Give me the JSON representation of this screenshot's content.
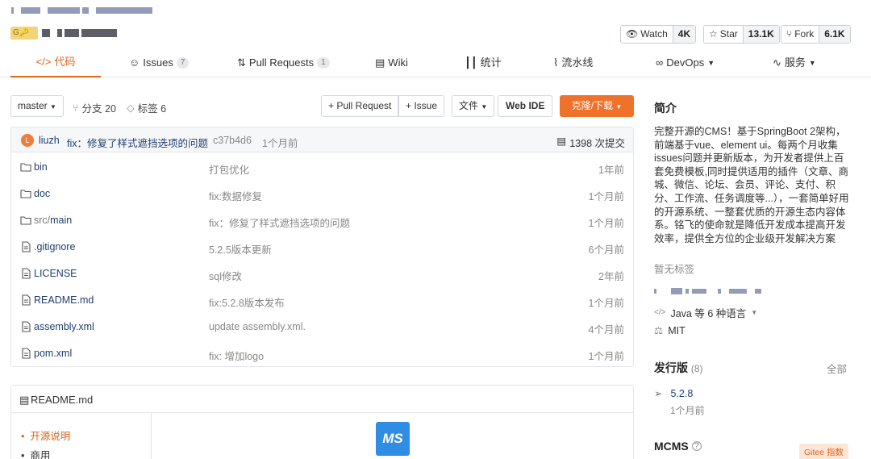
{
  "header": {
    "badge": "G",
    "stats": [
      {
        "label": "Watch",
        "icon": "eye-icon",
        "count": "4K"
      },
      {
        "label": "Star",
        "icon": "star-icon",
        "count": "13.1K"
      },
      {
        "label": "Fork",
        "icon": "fork-icon",
        "count": "6.1K"
      }
    ]
  },
  "tabs": [
    {
      "label": "代码",
      "icon": "code-icon",
      "count": ""
    },
    {
      "label": "Issues",
      "icon": "issues-icon",
      "count": "7"
    },
    {
      "label": "Pull Requests",
      "icon": "pull-request-icon",
      "count": "1"
    },
    {
      "label": "Wiki",
      "icon": "wiki-icon",
      "count": ""
    },
    {
      "label": "统计",
      "icon": "stats-icon",
      "count": ""
    },
    {
      "label": "流水线",
      "icon": "pipeline-icon",
      "count": ""
    },
    {
      "label": "DevOps",
      "icon": "devops-icon",
      "count": ""
    },
    {
      "label": "服务",
      "icon": "service-icon",
      "count": ""
    }
  ],
  "toolbar": {
    "branch": "master",
    "branches": "分支 20",
    "tags": "标签 6",
    "pull_request": "+ Pull Request",
    "issue": "+ Issue",
    "file": "文件",
    "web_ide": "Web IDE",
    "clone": "克隆/下载"
  },
  "commit": {
    "avatar": "L",
    "author": "liuzh",
    "message": "fix：修复了样式遮挡选项的问题",
    "hash": "c37b4d6",
    "time": "1个月前",
    "total": "1398 次提交"
  },
  "files": [
    {
      "name": "bin",
      "prefix": "",
      "type": "folder",
      "message": "打包优化",
      "time": "1年前"
    },
    {
      "name": "doc",
      "prefix": "",
      "type": "folder",
      "message": "fix:数据修复",
      "time": "1个月前"
    },
    {
      "name": "main",
      "prefix": "src/",
      "type": "folder",
      "message": "fix：修复了样式遮挡选项的问题",
      "time": "1个月前"
    },
    {
      "name": ".gitignore",
      "prefix": "",
      "type": "file",
      "message": "5.2.5版本更新",
      "time": "6个月前"
    },
    {
      "name": "LICENSE",
      "prefix": "",
      "type": "file",
      "message": "sql修改",
      "time": "2年前"
    },
    {
      "name": "README.md",
      "prefix": "",
      "type": "file",
      "message": "fix:5.2.8版本发布",
      "time": "1个月前"
    },
    {
      "name": "assembly.xml",
      "prefix": "",
      "type": "file",
      "message": "update assembly.xml.",
      "time": "4个月前"
    },
    {
      "name": "pom.xml",
      "prefix": "",
      "type": "file",
      "message": "fix: 增加logo",
      "time": "1个月前"
    }
  ],
  "readme": {
    "title": "README.md",
    "toc": [
      "开源说明",
      "商用"
    ],
    "logo": "MS"
  },
  "sidebar": {
    "intro_title": "简介",
    "intro": "完整开源的CMS！基于SpringBoot 2架构，前端基于vue、element ui。每两个月收集issues问题并更新版本，为开发者提供上百套免费模板,同时提供适用的插件（文章、商城、微信、论坛、会员、评论、支付、积分、工作流、任务调度等...），一套简单好用的开源系统、一整套优质的开源生态内容体系。铭飞的使命就是降低开发成本提高开发效率，提供全方位的企业级开发解决方案",
    "no_tags": "暂无标签",
    "language": "Java 等 6 种语言",
    "license": "MIT",
    "releases_title": "发行版",
    "releases_count": "(8)",
    "releases_all": "全部",
    "release_version": "5.2.8",
    "release_time": "1个月前",
    "mcms_title": "MCMS",
    "gitee_index": "Gitee 指数"
  }
}
